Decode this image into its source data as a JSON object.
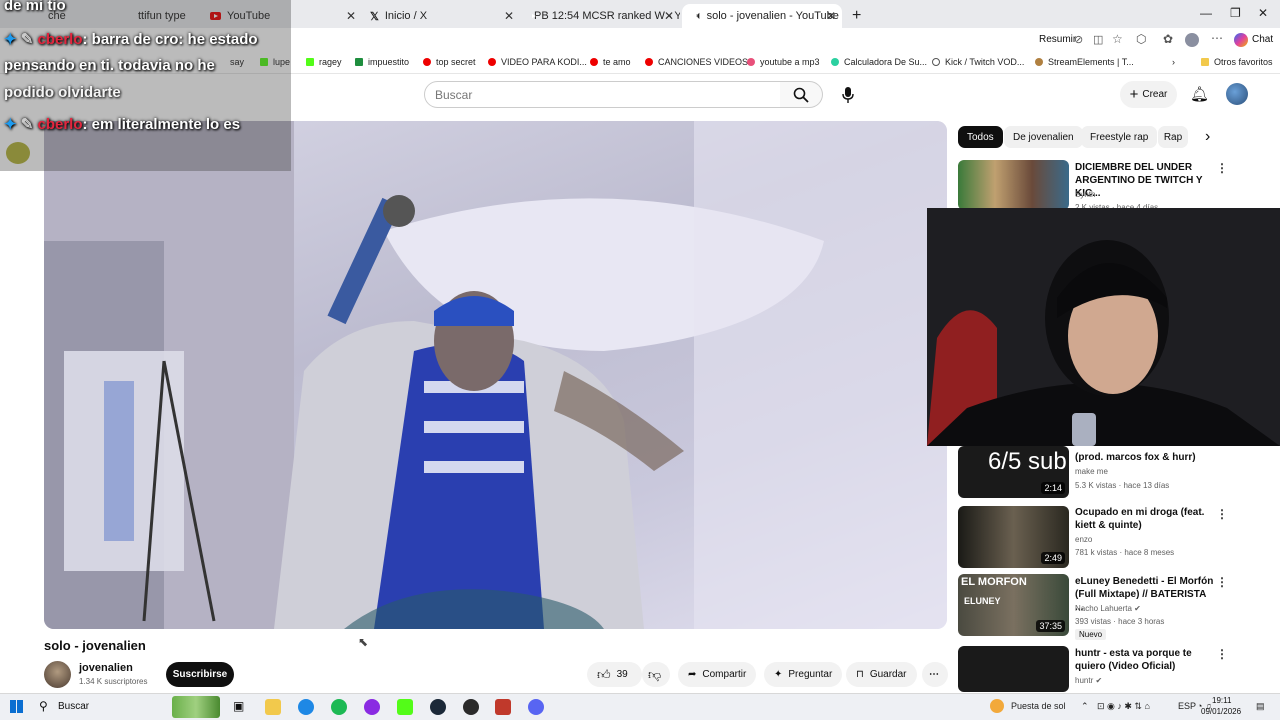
{
  "browser": {
    "tabs": [
      {
        "label": "che"
      },
      {
        "label": "ttifun type"
      },
      {
        "label": "YouTube"
      },
      {
        "label": "Inicio / X"
      },
      {
        "label": "PB 12:54 MCSR ranked W - YouTu"
      },
      {
        "label": "solo - jovenalien - YouTube"
      }
    ],
    "new_tab_icon": "plus-icon",
    "resume_label": "Resumir",
    "chat_label": "Chat"
  },
  "bookmarks": [
    {
      "label": "say"
    },
    {
      "label": "lupe"
    },
    {
      "label": "ragey"
    },
    {
      "label": "impuestito"
    },
    {
      "label": "top secret"
    },
    {
      "label": "VIDEO PARA KODI..."
    },
    {
      "label": "te amo"
    },
    {
      "label": "CANCIONES VIDEOS"
    },
    {
      "label": "youtube a mp3"
    },
    {
      "label": "Calculadora De Su..."
    },
    {
      "label": "Kick / Twitch VOD..."
    },
    {
      "label": "StreamElements | T..."
    },
    {
      "label": "Otros favoritos"
    }
  ],
  "stream_chat": {
    "line0": "de mi tio",
    "line1_name": "cberlo",
    "line1_text": ": barra de cro: he estado",
    "line2": "pensando en ti. todavia no he",
    "line3": "podido olvidarte",
    "line4_name": "cberlo",
    "line4_text": ": em literalmente lo es"
  },
  "youtube": {
    "search_placeholder": "Buscar",
    "create_label": "Crear",
    "chips": [
      "Todos",
      "De jovenalien",
      "Freestyle rap",
      "Rap"
    ],
    "video_title": "solo - jovenalien",
    "channel_name": "jovenalien",
    "subscribers": "1.34 K suscriptores",
    "subscribe_label": "Suscribirse",
    "likes": "39",
    "share_label": "Compartir",
    "ask_label": "Preguntar",
    "save_label": "Guardar"
  },
  "webcam_overlay_text": "6/5 sub",
  "recommendations": [
    {
      "title": "DICIEMBRE DEL UNDER ARGENTINO DE TWITCH Y KIC...",
      "channel": "Synth",
      "meta": "2 K vistas · hace 4 días",
      "duration": ""
    },
    {
      "title": "(prod. marcos fox & hurr)",
      "channel": "make me",
      "meta": "5.3 K vistas · hace 13 días",
      "duration": "2:14"
    },
    {
      "title": "Ocupado en mi droga (feat. kiett & quinte)",
      "channel": "enzo",
      "meta": "781 k vistas · hace 8 meses",
      "duration": "2:49"
    },
    {
      "title": "eLuney Benedetti - El Morfón (Full Mixtape) // BATERISTA ...",
      "channel": "Nacho Lahuerta",
      "meta": "393 vistas · hace 3 horas",
      "duration": "37:35",
      "badge": "Nuevo",
      "thumb_text": "EL MORFON",
      "thumb_text2": "ELUNEY"
    },
    {
      "title": "huntr - esta va porque te quiero (Video Oficial)",
      "channel": "huntr",
      "meta": "",
      "duration": ""
    }
  ],
  "taskbar": {
    "search_label": "Buscar",
    "weather": "Puesta de sol",
    "lang": "ESP",
    "time": "19:11",
    "date": "09/01/2026"
  },
  "colors": {
    "accent_red": "#e00000",
    "chat_name": "#e3263e"
  }
}
